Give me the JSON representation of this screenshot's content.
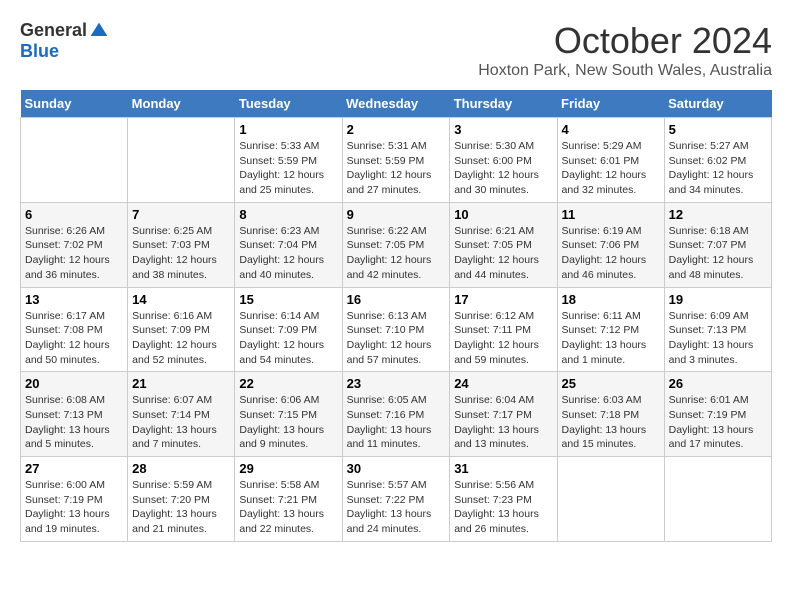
{
  "logo": {
    "general": "General",
    "blue": "Blue"
  },
  "title": "October 2024",
  "location": "Hoxton Park, New South Wales, Australia",
  "days_of_week": [
    "Sunday",
    "Monday",
    "Tuesday",
    "Wednesday",
    "Thursday",
    "Friday",
    "Saturday"
  ],
  "weeks": [
    [
      {
        "day": "",
        "info": ""
      },
      {
        "day": "",
        "info": ""
      },
      {
        "day": "1",
        "info": "Sunrise: 5:33 AM\nSunset: 5:59 PM\nDaylight: 12 hours and 25 minutes."
      },
      {
        "day": "2",
        "info": "Sunrise: 5:31 AM\nSunset: 5:59 PM\nDaylight: 12 hours and 27 minutes."
      },
      {
        "day": "3",
        "info": "Sunrise: 5:30 AM\nSunset: 6:00 PM\nDaylight: 12 hours and 30 minutes."
      },
      {
        "day": "4",
        "info": "Sunrise: 5:29 AM\nSunset: 6:01 PM\nDaylight: 12 hours and 32 minutes."
      },
      {
        "day": "5",
        "info": "Sunrise: 5:27 AM\nSunset: 6:02 PM\nDaylight: 12 hours and 34 minutes."
      }
    ],
    [
      {
        "day": "6",
        "info": "Sunrise: 6:26 AM\nSunset: 7:02 PM\nDaylight: 12 hours and 36 minutes."
      },
      {
        "day": "7",
        "info": "Sunrise: 6:25 AM\nSunset: 7:03 PM\nDaylight: 12 hours and 38 minutes."
      },
      {
        "day": "8",
        "info": "Sunrise: 6:23 AM\nSunset: 7:04 PM\nDaylight: 12 hours and 40 minutes."
      },
      {
        "day": "9",
        "info": "Sunrise: 6:22 AM\nSunset: 7:05 PM\nDaylight: 12 hours and 42 minutes."
      },
      {
        "day": "10",
        "info": "Sunrise: 6:21 AM\nSunset: 7:05 PM\nDaylight: 12 hours and 44 minutes."
      },
      {
        "day": "11",
        "info": "Sunrise: 6:19 AM\nSunset: 7:06 PM\nDaylight: 12 hours and 46 minutes."
      },
      {
        "day": "12",
        "info": "Sunrise: 6:18 AM\nSunset: 7:07 PM\nDaylight: 12 hours and 48 minutes."
      }
    ],
    [
      {
        "day": "13",
        "info": "Sunrise: 6:17 AM\nSunset: 7:08 PM\nDaylight: 12 hours and 50 minutes."
      },
      {
        "day": "14",
        "info": "Sunrise: 6:16 AM\nSunset: 7:09 PM\nDaylight: 12 hours and 52 minutes."
      },
      {
        "day": "15",
        "info": "Sunrise: 6:14 AM\nSunset: 7:09 PM\nDaylight: 12 hours and 54 minutes."
      },
      {
        "day": "16",
        "info": "Sunrise: 6:13 AM\nSunset: 7:10 PM\nDaylight: 12 hours and 57 minutes."
      },
      {
        "day": "17",
        "info": "Sunrise: 6:12 AM\nSunset: 7:11 PM\nDaylight: 12 hours and 59 minutes."
      },
      {
        "day": "18",
        "info": "Sunrise: 6:11 AM\nSunset: 7:12 PM\nDaylight: 13 hours and 1 minute."
      },
      {
        "day": "19",
        "info": "Sunrise: 6:09 AM\nSunset: 7:13 PM\nDaylight: 13 hours and 3 minutes."
      }
    ],
    [
      {
        "day": "20",
        "info": "Sunrise: 6:08 AM\nSunset: 7:13 PM\nDaylight: 13 hours and 5 minutes."
      },
      {
        "day": "21",
        "info": "Sunrise: 6:07 AM\nSunset: 7:14 PM\nDaylight: 13 hours and 7 minutes."
      },
      {
        "day": "22",
        "info": "Sunrise: 6:06 AM\nSunset: 7:15 PM\nDaylight: 13 hours and 9 minutes."
      },
      {
        "day": "23",
        "info": "Sunrise: 6:05 AM\nSunset: 7:16 PM\nDaylight: 13 hours and 11 minutes."
      },
      {
        "day": "24",
        "info": "Sunrise: 6:04 AM\nSunset: 7:17 PM\nDaylight: 13 hours and 13 minutes."
      },
      {
        "day": "25",
        "info": "Sunrise: 6:03 AM\nSunset: 7:18 PM\nDaylight: 13 hours and 15 minutes."
      },
      {
        "day": "26",
        "info": "Sunrise: 6:01 AM\nSunset: 7:19 PM\nDaylight: 13 hours and 17 minutes."
      }
    ],
    [
      {
        "day": "27",
        "info": "Sunrise: 6:00 AM\nSunset: 7:19 PM\nDaylight: 13 hours and 19 minutes."
      },
      {
        "day": "28",
        "info": "Sunrise: 5:59 AM\nSunset: 7:20 PM\nDaylight: 13 hours and 21 minutes."
      },
      {
        "day": "29",
        "info": "Sunrise: 5:58 AM\nSunset: 7:21 PM\nDaylight: 13 hours and 22 minutes."
      },
      {
        "day": "30",
        "info": "Sunrise: 5:57 AM\nSunset: 7:22 PM\nDaylight: 13 hours and 24 minutes."
      },
      {
        "day": "31",
        "info": "Sunrise: 5:56 AM\nSunset: 7:23 PM\nDaylight: 13 hours and 26 minutes."
      },
      {
        "day": "",
        "info": ""
      },
      {
        "day": "",
        "info": ""
      }
    ]
  ]
}
